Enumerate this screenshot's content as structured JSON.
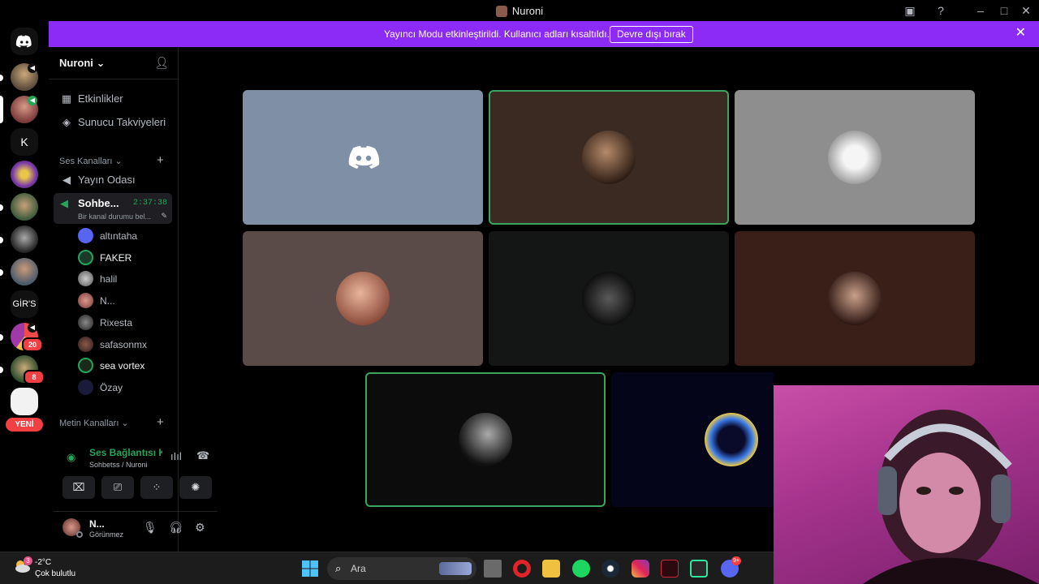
{
  "window": {
    "title": "Nuroni"
  },
  "banner": {
    "message": "Yayıncı Modu etkinleştirildi. Kullanıcı adları kısaltıldı.",
    "button_label": "Devre dışı bırak"
  },
  "rail": {
    "letter_server": "K",
    "gir_server": "GİR'S",
    "new_label": "YENİ",
    "badge_1": "20",
    "badge_2": "8"
  },
  "sidebar": {
    "guild_name": "Nuroni ⌄",
    "events_label": "Etkinlikler",
    "boosts_label": "Sunucu Takviyeleri",
    "voice_category": "Ses Kanalları ⌄",
    "broadcast_room": "Yayın Odası",
    "active_channel": {
      "name": "Sohbe...",
      "time": "2:37:38",
      "status": "Bir kanal durumu bel..."
    },
    "members": [
      "altıntaha",
      "FAKER",
      "halil",
      "N...",
      "Rixesta",
      "safasonmx",
      "sea vortex",
      "Özay"
    ],
    "text_category": "Metin Kanalları ⌄"
  },
  "voice_panel": {
    "connection": "Ses Bağlantısı Kuruldu",
    "location": "Sohbetss / Nuroni"
  },
  "user_panel": {
    "name": "N...",
    "status": "Görünmez"
  },
  "taskbar": {
    "temperature": "-2°C",
    "condition": "Çok bulutlu",
    "search_placeholder": "Ara",
    "weather_badge": "3",
    "discord_badge": "9+"
  },
  "colors": {
    "banner": "#8c2bf5",
    "speaking": "#3ba55c",
    "connected": "#23a55a",
    "tile_discord": "#7e8fa6"
  }
}
